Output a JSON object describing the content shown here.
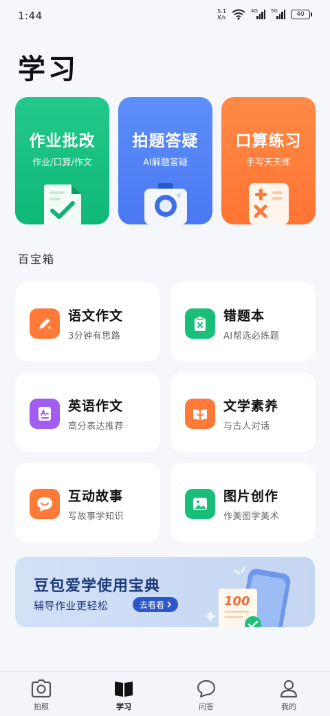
{
  "status_bar": {
    "time": "1:44",
    "net_speed_value": "5.1",
    "net_speed_unit": "K/s",
    "signal1_label": "4G",
    "signal2_label": "5G",
    "battery": "40"
  },
  "page": {
    "title": "学习"
  },
  "hero_cards": [
    {
      "title": "作业批改",
      "subtitle": "作业/口算/作文",
      "color": "#16bf7f",
      "icon": "document-check-icon"
    },
    {
      "title": "拍题答疑",
      "subtitle": "AI解题答疑",
      "color": "#527ff5",
      "icon": "camera-icon"
    },
    {
      "title": "口算练习",
      "subtitle": "手写天天练",
      "color": "#ff7b3a",
      "icon": "calculator-icon"
    }
  ],
  "toolbox": {
    "title": "百宝箱",
    "items": [
      {
        "title": "语文作文",
        "subtitle": "3分钟有思路",
        "icon": "pen-sparkle-icon",
        "color": "#ff7a38"
      },
      {
        "title": "错题本",
        "subtitle": "AI帮选必练题",
        "icon": "wrong-clipboard-icon",
        "color": "#19bf79"
      },
      {
        "title": "英语作文",
        "subtitle": "高分表达推荐",
        "icon": "english-doc-icon",
        "color": "#a35cf0"
      },
      {
        "title": "文学素养",
        "subtitle": "与古人对话",
        "icon": "open-book-icon",
        "color": "#ff7a38"
      },
      {
        "title": "互动故事",
        "subtitle": "写故事学知识",
        "icon": "chat-smile-icon",
        "color": "#ff7a38"
      },
      {
        "title": "图片创作",
        "subtitle": "作美图学美术",
        "icon": "image-icon",
        "color": "#19bf79"
      }
    ]
  },
  "banner": {
    "title": "豆包爱学使用宝典",
    "subtitle": "辅导作业更轻松",
    "button": "去看看"
  },
  "bottom_nav": [
    {
      "label": "拍照",
      "icon": "camera-outline-icon",
      "active": false
    },
    {
      "label": "学习",
      "icon": "book-icon",
      "active": true
    },
    {
      "label": "问答",
      "icon": "chat-bubble-icon",
      "active": false
    },
    {
      "label": "我的",
      "icon": "person-icon",
      "active": false
    }
  ]
}
